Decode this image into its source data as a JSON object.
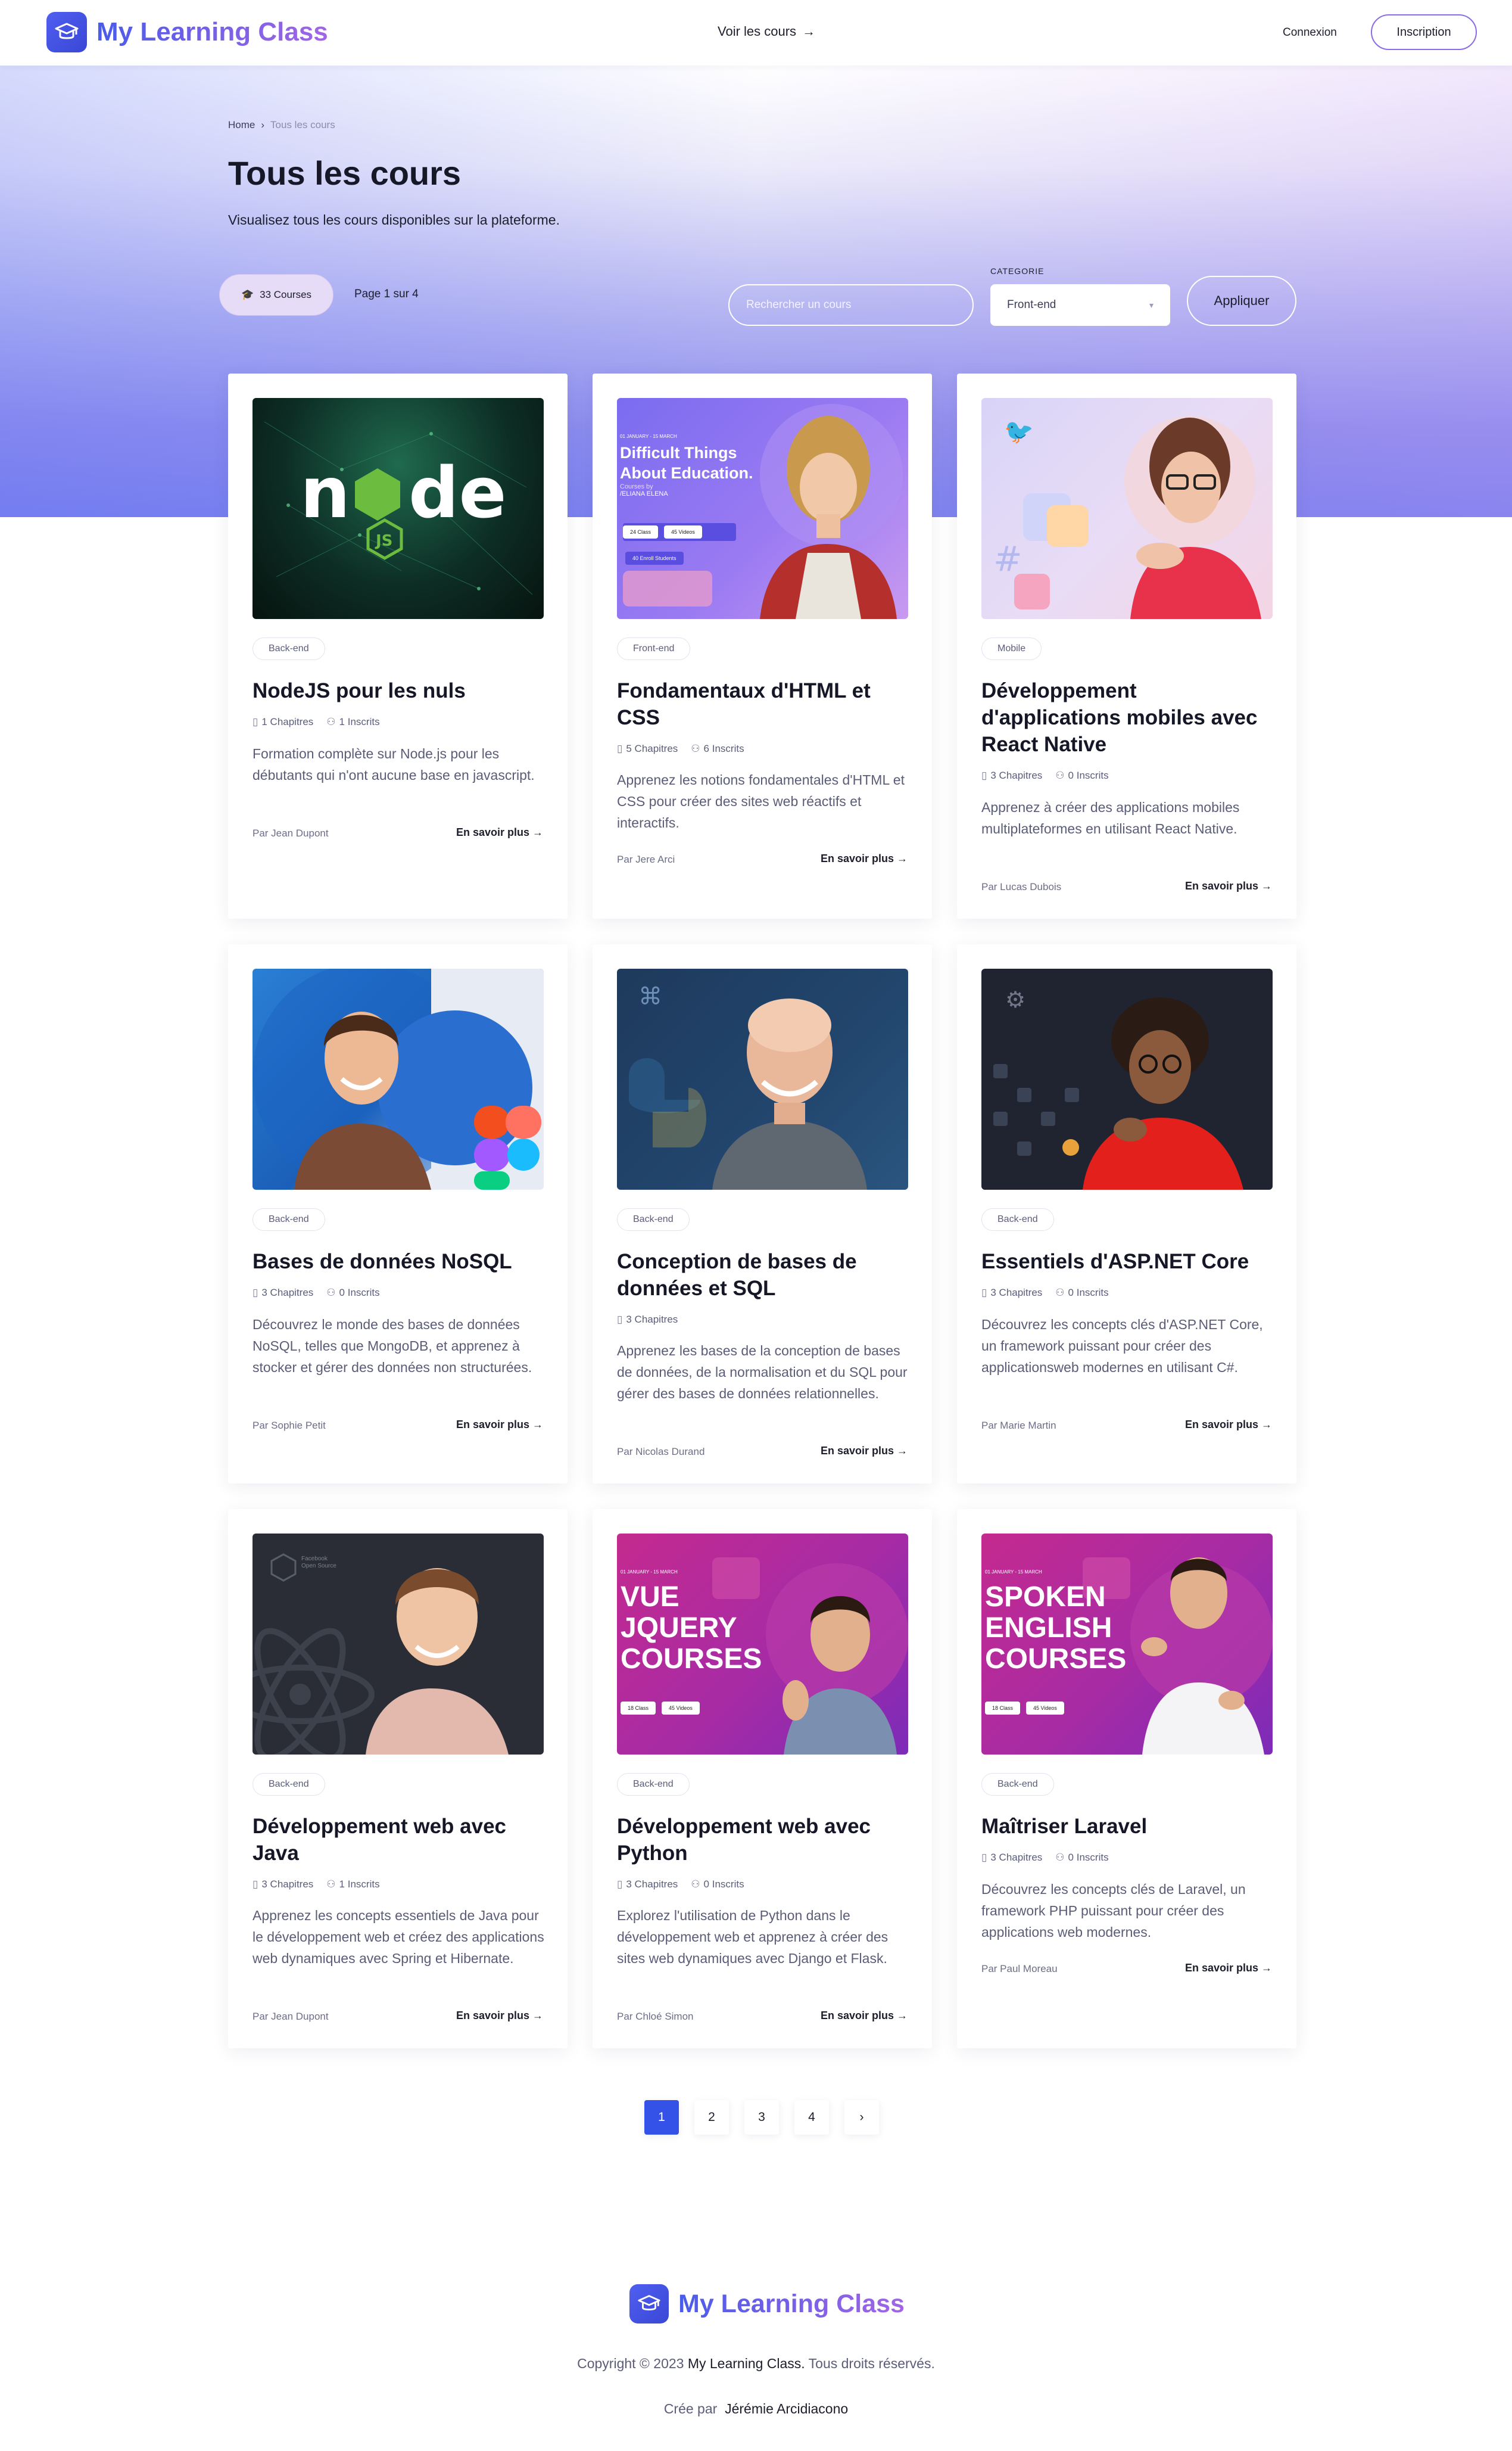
{
  "brand": {
    "name": "My Learning Class"
  },
  "nav": {
    "courses_link": "Voir les cours",
    "login": "Connexion",
    "signup": "Inscription"
  },
  "breadcrumb": {
    "home": "Home",
    "current": "Tous les cours"
  },
  "header": {
    "title": "Tous les cours",
    "subtitle": "Visualisez tous les cours disponibles sur la plateforme."
  },
  "filters": {
    "count_label": "33 Courses",
    "page_label": "Page 1 sur 4",
    "search_placeholder": "Rechercher un cours",
    "category_label": "CATEGORIE",
    "category_value": "Front-end",
    "apply_label": "Appliquer"
  },
  "courses": [
    {
      "category": "Back-end",
      "title": "NodeJS pour les nuls",
      "chapters": "1 Chapitres",
      "enrolled": "1 Inscrits",
      "description": "Formation complète sur Node.js pour les débutants qui n'ont aucune base en javascript.",
      "author": "Par Jean Dupont",
      "more": "En savoir plus"
    },
    {
      "category": "Front-end",
      "title": "Fondamentaux d'HTML et CSS",
      "chapters": "5 Chapitres",
      "enrolled": "6 Inscrits",
      "description": "Apprenez les notions fondamentales d'HTML et CSS pour créer des sites web réactifs et interactifs.",
      "author": "Par Jere Arci",
      "more": "En savoir plus",
      "thumb_text": {
        "date": "01 JANUARY - 15 MARCH",
        "headline": "Difficult Things About Education.",
        "by": "Courses by",
        "name": "/ELIANA ELENA",
        "stat1": "24 Class",
        "stat2": "45 Videos",
        "stat3": "40 Enroll Students"
      }
    },
    {
      "category": "Mobile",
      "title": "Développement d'applications mobiles avec React Native",
      "chapters": "3 Chapitres",
      "enrolled": "0 Inscrits",
      "description": "Apprenez à créer des applications mobiles multiplateformes en utilisant React Native.",
      "author": "Par Lucas Dubois",
      "more": "En savoir plus"
    },
    {
      "category": "Back-end",
      "title": "Bases de données NoSQL",
      "chapters": "3 Chapitres",
      "enrolled": "0 Inscrits",
      "description": "Découvrez le monde des bases de données NoSQL, telles que MongoDB, et apprenez à stocker et gérer des données non structurées.",
      "author": "Par Sophie Petit",
      "more": "En savoir plus"
    },
    {
      "category": "Back-end",
      "title": "Conception de bases de données et SQL",
      "chapters": "3 Chapitres",
      "enrolled": "0 Inscrits",
      "description": "Apprenez les bases de la conception de bases de données, de la normalisation et du SQL pour gérer des bases de données relationnelles.",
      "author": "Par Nicolas Durand",
      "more": "En savoir plus"
    },
    {
      "category": "Back-end",
      "title": "Essentiels d'ASP.NET Core",
      "chapters": "3 Chapitres",
      "enrolled": "0 Inscrits",
      "description": "Découvrez les concepts clés d'ASP.NET Core, un framework puissant pour créer des applicationsweb modernes en utilisant C#.",
      "author": "Par Marie Martin",
      "more": "En savoir plus"
    },
    {
      "category": "Back-end",
      "title": "Développement web avec Java",
      "chapters": "3 Chapitres",
      "enrolled": "1 Inscrits",
      "description": "Apprenez les concepts essentiels de Java pour le développement web et créez des applications web dynamiques avec Spring et Hibernate.",
      "author": "Par Jean Dupont",
      "more": "En savoir plus",
      "thumb_text": {
        "brand": "Facebook Open Source"
      }
    },
    {
      "category": "Back-end",
      "title": "Développement web avec Python",
      "chapters": "3 Chapitres",
      "enrolled": "0 Inscrits",
      "description": "Explorez l'utilisation de Python dans le développement web et apprenez à créer des sites web dynamiques avec Django et Flask.",
      "author": "Par Chloé Simon",
      "more": "En savoir plus",
      "thumb_text": {
        "date": "01 JANUARY - 15 MARCH",
        "headline": "VUE JQUERY COURSES",
        "stat1": "18 Class",
        "stat2": "45 Videos"
      }
    },
    {
      "category": "Back-end",
      "title": "Maîtriser Laravel",
      "chapters": "3 Chapitres",
      "enrolled": "0 Inscrits",
      "description": "Découvrez les concepts clés de Laravel, un framework PHP puissant pour créer des applications web modernes.",
      "author": "Par Paul Moreau",
      "more": "En savoir plus",
      "thumb_text": {
        "date": "01 JANUARY - 15 MARCH",
        "headline": "SPOKEN ENGLISH COURSES",
        "stat1": "18 Class",
        "stat2": "45 Videos"
      }
    }
  ],
  "pagination": {
    "pages": [
      "1",
      "2",
      "3",
      "4"
    ],
    "current": "1",
    "next": "›"
  },
  "footer": {
    "brand": "My Learning Class",
    "copyright_prefix": "Copyright © 2023",
    "copyright_brand": "My Learning Class.",
    "copyright_suffix": "Tous droits réservés.",
    "credit_prefix": "Crée par",
    "credit_name": "Jérémie Arcidiacono"
  },
  "colors": {
    "accent": "#3552e8",
    "brand_gradient_start": "#4a5ce8",
    "brand_gradient_end": "#a265e6"
  }
}
